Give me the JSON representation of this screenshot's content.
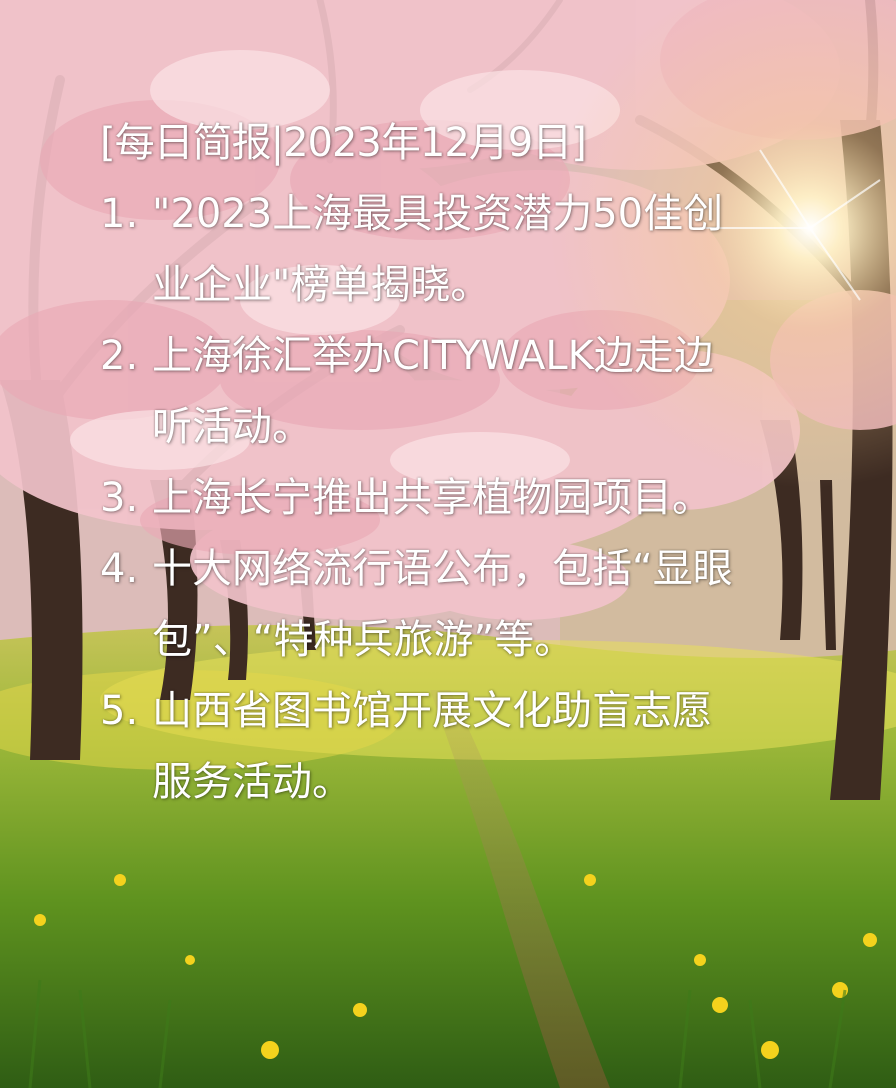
{
  "heading": "[每日简报|2023年12月9日]",
  "items": [
    {
      "num": "1.",
      "text": "\"2023上海最具投资潜力50佳创业企业\"榜单揭晓。"
    },
    {
      "num": "2.",
      "text": "上海徐汇举办CITYWALK边走边听活动。"
    },
    {
      "num": "3.",
      "text": "上海长宁推出共享植物园项目。"
    },
    {
      "num": "4.",
      "text": "十大网络流行语公布，包括“显眼包”、“特种兵旅游”等。"
    },
    {
      "num": "5.",
      "text": "山西省图书馆开展文化助盲志愿服务活动。"
    }
  ],
  "colors": {
    "text": "#ffffff",
    "blossom": "#f3c6cf",
    "grass": "#6e9f2a",
    "sun": "#fff6d6"
  }
}
